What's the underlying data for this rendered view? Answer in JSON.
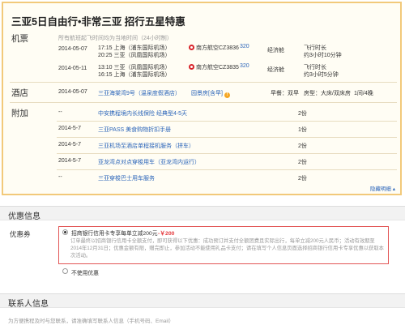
{
  "summary": {
    "title": "三亚5日自由行•非常三亚 招行五星特惠",
    "flight": {
      "label": "机票",
      "note": "所有航班起飞时间均为当地时间（24小时制）",
      "rows": [
        {
          "date": "2014-05-07",
          "dep": "17:15 上海（浦东国际机场）",
          "arr": "20:25 三亚（凤凰国际机场）",
          "airline": "南方航空CZ3836",
          "plane": "320",
          "cabin": "经济舱",
          "type": "飞行时长",
          "duration": "约3小时10分钟"
        },
        {
          "date": "2014-05-11",
          "dep": "13:10 三亚（凤凰国际机场）",
          "arr": "16:15 上海（浦东国际机场）",
          "airline": "南方航空CZ3835",
          "plane": "320",
          "cabin": "经济舱",
          "type": "飞行时长",
          "duration": "约3小时5分钟"
        }
      ]
    },
    "hotel": {
      "label": "酒店",
      "date": "2014-05-07",
      "name": "三亚海棠湾9号（温泉度假酒店）",
      "room": "园景房[含早]",
      "info_icon": "!",
      "breakfast": "早餐：双早",
      "bed": "房型：大床/双床房",
      "count": "1间/4晚"
    },
    "extras": {
      "label": "附加",
      "rows": [
        {
          "date": "--",
          "name": "中安携程境内长线保险 经典型4-5天",
          "qty": "2份"
        },
        {
          "date": "2014-5-7",
          "name": "三亚PASS 美食购物折扣手册",
          "qty": "1份"
        },
        {
          "date": "2014-5-7",
          "name": "三亚机场至酒店单程接机服务（拼车）",
          "qty": "2份"
        },
        {
          "date": "2014-5-7",
          "name": "亚龙湾点对点穿梭用车（亚龙湾内运行）",
          "qty": "2份"
        },
        {
          "date": "--",
          "name": "三亚穿梭巴士用车服务",
          "qty": "2份"
        }
      ]
    },
    "collapse": "隐藏明细 ▴"
  },
  "coupon": {
    "header": "优惠信息",
    "label": "优惠券",
    "option_title": "招商银行信用卡专享每单立减200元",
    "option_amount": "-￥200",
    "option_desc": "订单最终以招商银行信用卡全额支付，即可获得以下优惠：成功预订并支付全额团费且实际出行，每单立减200元人民币；活动有效期至2014年12月31日；优惠金额有限，赠完即止，参加活动不能使用礼品卡支付；请在填写个人信息页面选择招商银行信用卡专享优惠以获取本次活动。",
    "none_label": "不使用优惠"
  },
  "contact": {
    "header": "联系人信息",
    "hint": "为方便携程及时与您联系，请准确填写联系人信息（手机号码、Email）"
  }
}
